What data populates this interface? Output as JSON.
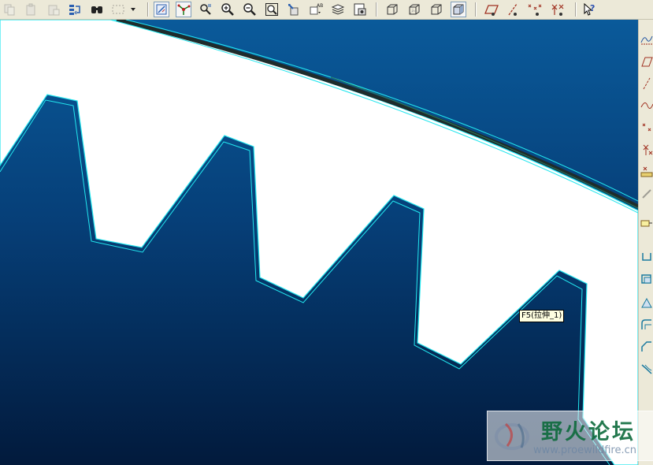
{
  "toolbar": {
    "buttons": [
      {
        "name": "copy-icon"
      },
      {
        "name": "paste-icon"
      },
      {
        "name": "paste-special-icon"
      },
      {
        "name": "regenerate-icon"
      },
      {
        "name": "find-icon"
      },
      {
        "name": "select-box-icon"
      },
      {
        "name": "dropdown-arrow-icon"
      },
      {
        "name": "datum-display-icon"
      },
      {
        "name": "spin-center-icon"
      },
      {
        "name": "view-manager-icon"
      },
      {
        "name": "zoom-in-icon"
      },
      {
        "name": "zoom-out-icon"
      },
      {
        "name": "refit-icon"
      },
      {
        "name": "reorient-icon"
      },
      {
        "name": "saved-views-icon"
      },
      {
        "name": "layers-icon"
      },
      {
        "name": "view-manager-2-icon"
      },
      {
        "name": "wireframe-icon"
      },
      {
        "name": "hidden-line-icon"
      },
      {
        "name": "no-hidden-icon"
      },
      {
        "name": "shading-icon"
      },
      {
        "name": "datum-planes-icon"
      },
      {
        "name": "datum-axes-icon"
      },
      {
        "name": "datum-points-icon"
      },
      {
        "name": "coordinate-systems-icon"
      },
      {
        "name": "context-help-icon"
      }
    ]
  },
  "tooltip": {
    "text": "F5(拉伸_1)"
  },
  "watermark": {
    "title": "野火论坛",
    "url": "www.proewildfire.cn"
  },
  "colors": {
    "background_top": "#0a5a9a",
    "background_bottom": "#021a3c",
    "edge_highlight": "#22e6ee",
    "gear_face": "#ffffff"
  }
}
